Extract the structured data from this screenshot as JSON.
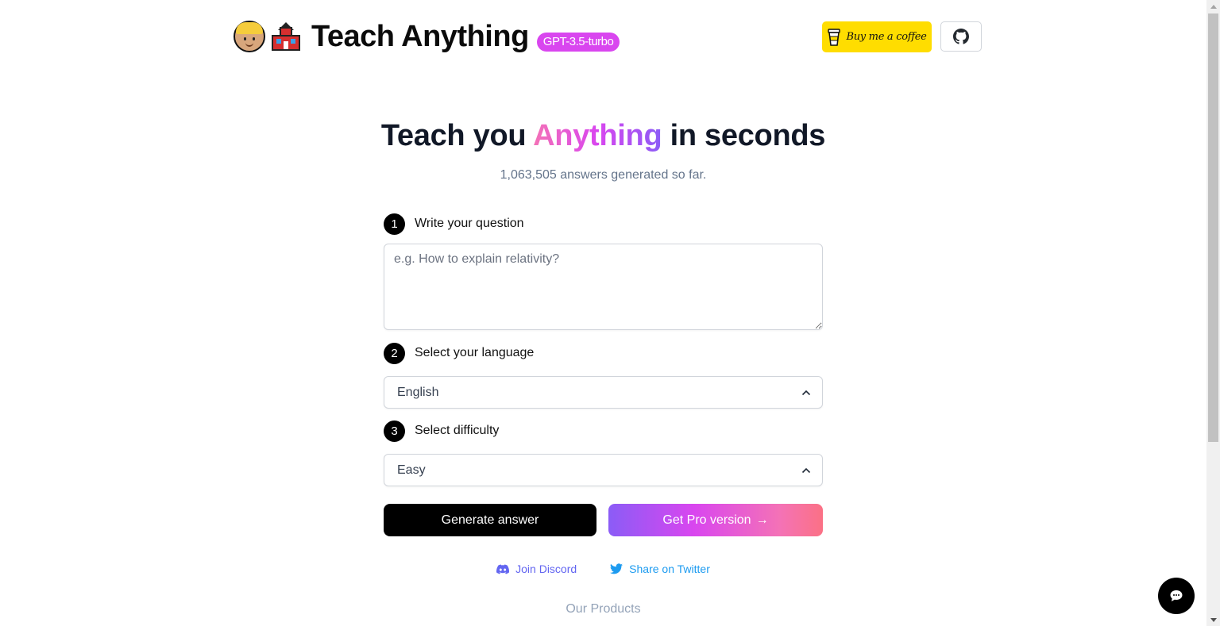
{
  "header": {
    "icons": [
      "boy-emoji-icon",
      "school-emoji-icon"
    ],
    "title": "Teach Anything",
    "model_badge": "GPT-3.5-turbo",
    "coffee_button": {
      "label": "Buy me a coffee",
      "icon": "coffee-cup-icon",
      "color": "#ffdd00"
    },
    "github_button": {
      "icon": "github-icon"
    }
  },
  "hero": {
    "title_before": "Teach you ",
    "title_highlight": "Anything",
    "title_after": " in seconds",
    "counter": "1,063,505 answers generated so far."
  },
  "form": {
    "steps": [
      {
        "number": "1",
        "label": "Write your question"
      },
      {
        "number": "2",
        "label": "Select your language"
      },
      {
        "number": "3",
        "label": "Select difficulty"
      }
    ],
    "question": {
      "value": "",
      "placeholder": "e.g. How to explain relativity?"
    },
    "language": {
      "selected": "English"
    },
    "difficulty": {
      "selected": "Easy"
    },
    "generate_button": "Generate answer",
    "pro_button": "Get Pro version",
    "pro_arrow": "→"
  },
  "links": {
    "discord": {
      "label": "Join Discord",
      "icon": "discord-icon",
      "color": "#6366f1"
    },
    "twitter": {
      "label": "Share on Twitter",
      "icon": "twitter-icon",
      "color": "#1d9bf0"
    }
  },
  "footer": {
    "products_heading": "Our Products"
  },
  "chat": {
    "icon": "chat-bubble-icon"
  },
  "colors": {
    "accent_pink": "#f472b6",
    "accent_fuchsia": "#d946ef",
    "accent_violet": "#8b5cf6"
  }
}
